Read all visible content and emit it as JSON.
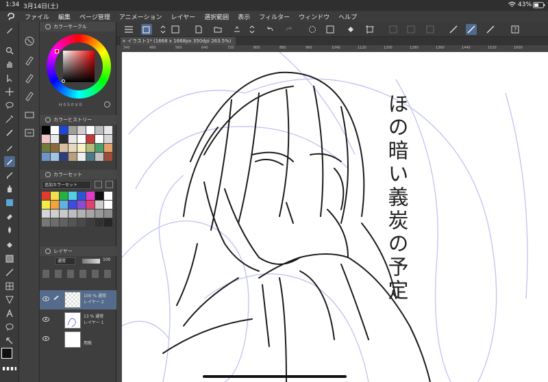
{
  "status": {
    "time": "1:34",
    "date": "3月14日(土)",
    "battery": "43%"
  },
  "menu": {
    "items": [
      "ファイル",
      "編集",
      "ページ管理",
      "アニメーション",
      "レイヤー",
      "選択範囲",
      "表示",
      "フィルター",
      "ウィンドウ",
      "ヘルプ"
    ]
  },
  "panels": {
    "color_circle": {
      "title": "カラーサークル",
      "values": "H 0  S 0  V 0"
    },
    "color_history": {
      "title": "カラーヒストリー"
    },
    "color_set": {
      "title": "カラーセット",
      "set_name": "追加カラーセット"
    },
    "layer": {
      "title": "レイヤー",
      "blend_mode": "通常",
      "opacity": "100"
    }
  },
  "layers": [
    {
      "opacity": "100 %",
      "mode": "通常",
      "name": "レイヤー 2"
    },
    {
      "opacity": "13 %",
      "mode": "通常",
      "name": "レイヤー 1"
    },
    {
      "opacity": "",
      "mode": "",
      "name": "用紙"
    }
  ],
  "canvas": {
    "tab_title": "イラスト1* (1668 x 1668px 350dpi 263.5%)",
    "ruler_labels": [
      "340",
      "480",
      "560",
      "640",
      "720",
      "800",
      "880",
      "960",
      "1040",
      "1120",
      "1200",
      "1280",
      "1360",
      "1440",
      "1520",
      "1600"
    ],
    "handwriting": "ほの暗い義炭の予定"
  },
  "colors": {
    "accent": "#4f6a8e",
    "history": [
      "#000000",
      "#ffffff",
      "#1a47d8",
      "#9f9f9f",
      "#cfcfcf",
      "#ffffff",
      "#bcbcbc",
      "#e7e7e7",
      "#f2c4c4",
      "#e9e9e9",
      "#2d2d2d",
      "#e8e8e8",
      "#fefefe",
      "#c33a3a",
      "#ffffff",
      "#d6d6d6",
      "#6e7b3b",
      "#8a6a3b",
      "#d9bfa2",
      "#e7d8c0",
      "#faf2c5",
      "#b2bd7a",
      "#4ca06b",
      "#e2a16a",
      "#6d96c7",
      "#a0c4e3",
      "#2c3f7c",
      "#b9a07c",
      "#eeeeee",
      "#4c7a86",
      "#c2c2c2",
      "#a04a3a"
    ],
    "set": [
      "#e23a2b",
      "#f4e04a",
      "#27b23f",
      "#4fd0e3",
      "#2b57d6",
      "#e43ac9",
      "#111111",
      "#fefefe",
      "#f5ec45",
      "#f3a33a",
      "#5fb3e2",
      "#3f4ae0",
      "#8b4bd6",
      "#e23e6e",
      "#cccccc",
      "#ffffff",
      "#d5d5d5",
      "#cfcfcf",
      "#c9c9c9",
      "#bdbdbd",
      "#b2b2b2",
      "#a6a6a6",
      "#9a9a9a",
      "#8e8e8e",
      "#777777",
      "#6c6c6c",
      "#616161",
      "#555555",
      "#494949",
      "#3d3d3d",
      "#313131",
      "#262626"
    ]
  }
}
